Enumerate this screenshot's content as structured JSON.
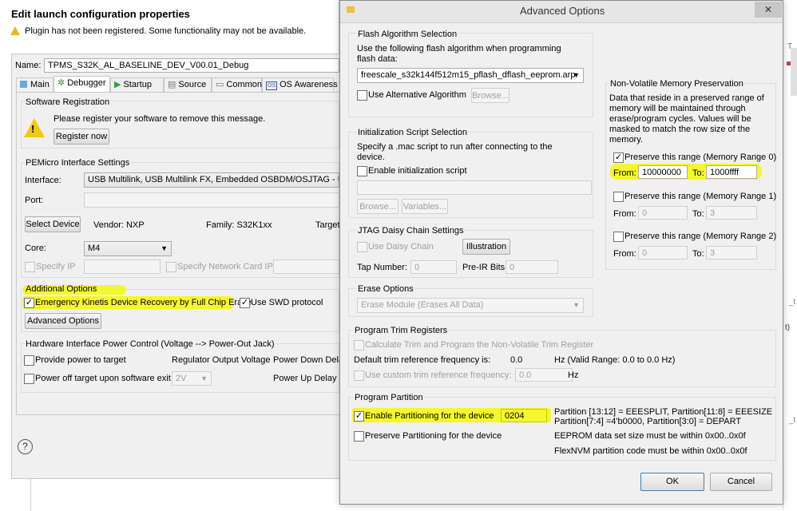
{
  "launch": {
    "title": "Edit launch configuration properties",
    "warning": "Plugin has not been registered. Some functionality may not be available.",
    "name_label": "Name:",
    "name_value": "TPMS_S32K_AL_BASELINE_DEV_V00.01_Debug",
    "tabs": [
      {
        "label": "Main"
      },
      {
        "label": "Debugger"
      },
      {
        "label": "Startup"
      },
      {
        "label": "Source"
      },
      {
        "label": "Common"
      },
      {
        "label": "OS Awareness"
      }
    ],
    "software_registration": {
      "title": "Software Registration",
      "message": "Please register your software to remove this message.",
      "button": "Register now"
    },
    "interface_settings": {
      "title": "PEMicro Interface Settings",
      "interface_label": "Interface:",
      "interface_value": "USB Multilink, USB Multilink FX, Embedded OSBDM/OSJTAG - USB P",
      "port_label": "Port:",
      "select_device": "Select Device",
      "vendor": "Vendor: NXP",
      "family": "Family: S32K1xx",
      "target": "Target",
      "core_label": "Core:",
      "core_value": "M4",
      "specify_ip": "Specify IP",
      "specify_network": "Specify Network Card IP"
    },
    "additional_options": {
      "title": "Additional Options",
      "emergency": "Emergency Kinetis Device Recovery by Full Chip Erase",
      "use_swd": "Use SWD protocol",
      "advanced_button": "Advanced Options"
    },
    "power_control": {
      "title": "Hardware Interface Power Control (Voltage --> Power-Out Jack)",
      "provide_power": "Provide power to target",
      "regulator": "Regulator Output Voltage",
      "power_down": "Power Down Delay",
      "power_off": "Power off target upon software exit",
      "voltage": "2V",
      "power_up": "Power Up Delay"
    },
    "help": "?"
  },
  "advanced": {
    "title": "Advanced Options",
    "close": "✕",
    "flash": {
      "title": "Flash Algorithm Selection",
      "desc1": "Use the following flash algorithm when programming",
      "desc2": "flash data:",
      "algorithm": "freescale_s32k144f512m15_pflash_dflash_eeprom.arp",
      "use_alt": "Use Alternative Algorithm",
      "browse": "Browse..."
    },
    "init": {
      "title": "Initialization Script Selection",
      "desc1": "Specify a .mac script to run after connecting to the",
      "desc2": "device.",
      "enable": "Enable initialization script",
      "browse": "Browse...",
      "variables": "Variables..."
    },
    "jtag": {
      "title": "JTAG Daisy Chain Settings",
      "use": "Use Daisy Chain",
      "illustration": "Illustration",
      "tap_label": "Tap Number:",
      "tap_value": "0",
      "preir_label": "Pre-IR Bits:",
      "preir_value": "0"
    },
    "erase": {
      "title": "Erase Options",
      "value": "Erase Module (Erases All Data)"
    },
    "trim": {
      "title": "Program Trim Registers",
      "calc": "Calculate Trim and Program the Non-Volatile Trim Register",
      "default_label": "Default trim reference frequency is:",
      "default_value": "0.0",
      "hz_range": "Hz (Valid Range: 0.0 to 0.0 Hz)",
      "custom": "Use custom trim reference frequency:",
      "custom_value": "0.0",
      "hz": "Hz"
    },
    "partition": {
      "title": "Program Partition",
      "enable": "Enable Partitioning for the device",
      "value": "0204",
      "preserve": "Preserve Partitioning for the device",
      "info1": "Partition [13:12] = EEESPLIT, Partition[11:8] = EEESIZE",
      "info2": "Partition[7:4] =4'b0000, Partition[3:0] = DEPART",
      "info3": "EEPROM data set size must be within 0x00..0x0f",
      "info4": "FlexNVM partition code must be within 0x00..0x0f"
    },
    "nvm": {
      "title": "Non-Volatile Memory Preservation",
      "desc1": "Data that reside in a preserved range of",
      "desc2": "memory will be maintained through",
      "desc3": "erase/program cycles. Values will be",
      "desc4": "masked to match the row size of the",
      "desc5": "memory.",
      "range0": "Preserve this range (Memory Range 0)",
      "range1": "Preserve this range (Memory Range 1)",
      "range2": "Preserve this range (Memory Range 2)",
      "from": "From:",
      "to": "To:",
      "r0_from": "10000000",
      "r0_to": "1000ffff",
      "r1_from": "0",
      "r1_to": "3",
      "r2_from": "0",
      "r2_to": "3"
    },
    "ok": "OK",
    "cancel": "Cancel"
  },
  "background_fragments": [
    "T.",
    "_t",
    "t)",
    "_t"
  ]
}
